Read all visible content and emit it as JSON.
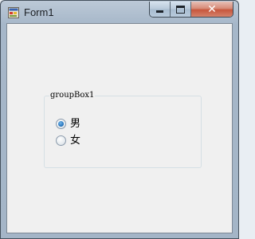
{
  "window": {
    "title": "Form1",
    "close_glyph": "✕"
  },
  "groupbox": {
    "label": "groupBox1",
    "radios": [
      {
        "label": "男",
        "checked": true
      },
      {
        "label": "女",
        "checked": false
      }
    ]
  },
  "colors": {
    "client_bg": "#f0f0f0",
    "titlebar_bg": "#b3c3d3",
    "close_button": "#c7573d",
    "radio_checked": "#2e7bc2"
  }
}
